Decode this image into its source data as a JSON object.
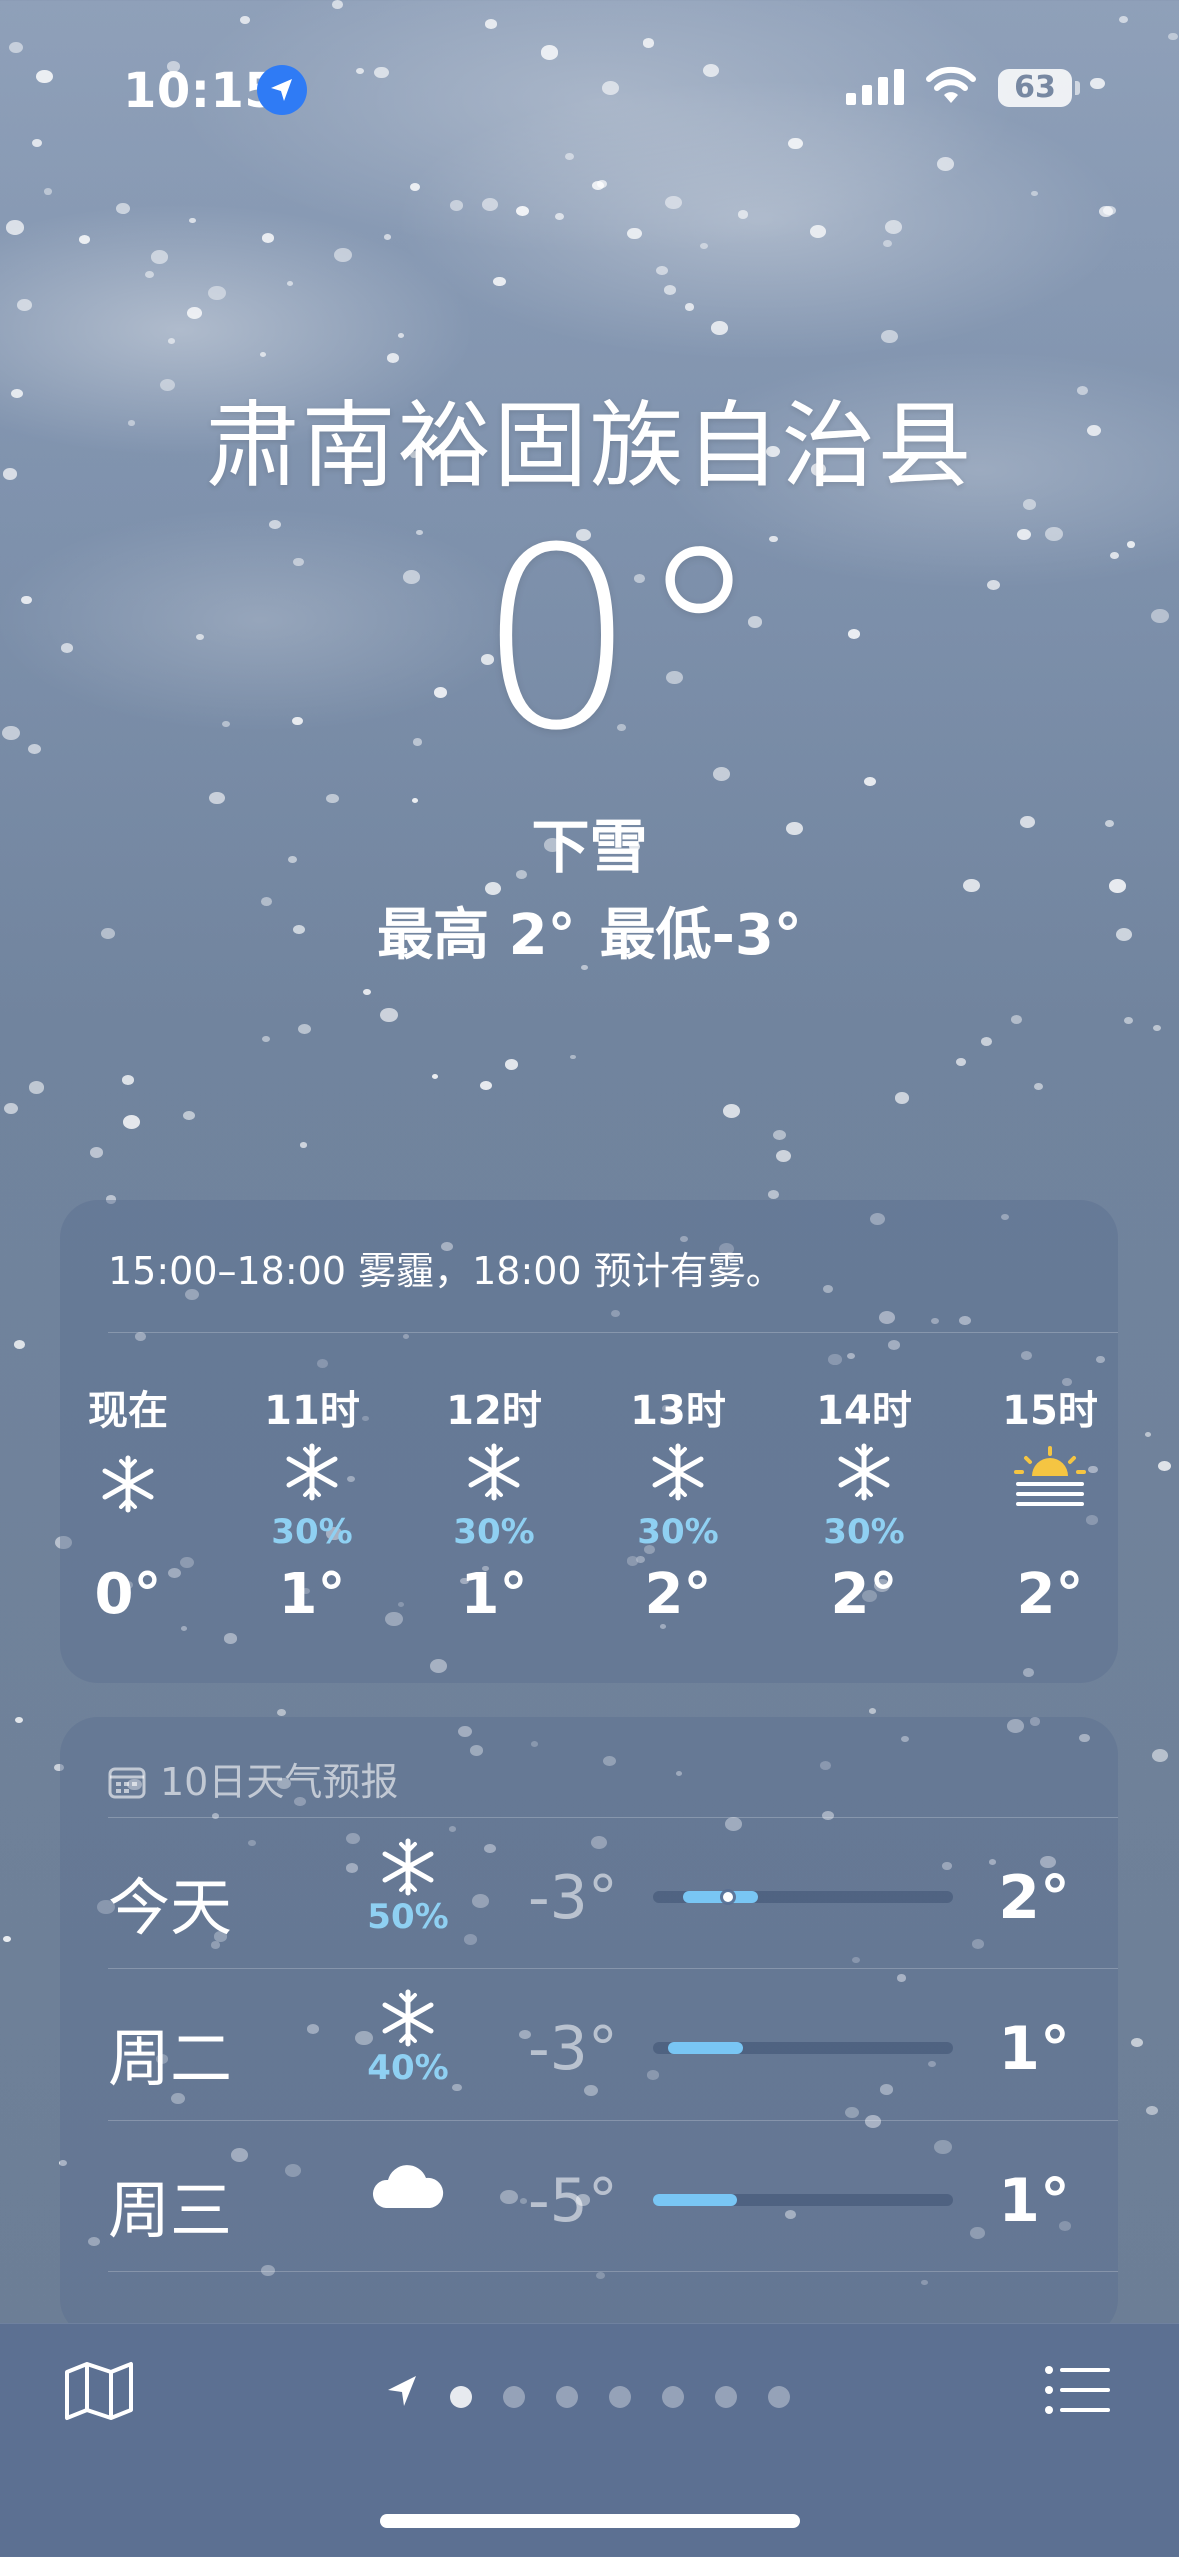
{
  "status_bar": {
    "time": "10:15",
    "battery": "63"
  },
  "hero": {
    "city": "肃南裕固族自治县",
    "temperature": "0°",
    "condition": "下雪",
    "high": "最高 2°",
    "low": "最低-3°"
  },
  "hourly": {
    "summary": "15:00–18:00 雾霾，18:00 预计有雾。",
    "items": [
      {
        "label": "现在",
        "icon": "snowflake-icon",
        "precip": "",
        "temp": "0°"
      },
      {
        "label": "11时",
        "icon": "snowflake-icon",
        "precip": "30%",
        "temp": "1°"
      },
      {
        "label": "12时",
        "icon": "snowflake-icon",
        "precip": "30%",
        "temp": "1°"
      },
      {
        "label": "13时",
        "icon": "snowflake-icon",
        "precip": "30%",
        "temp": "2°"
      },
      {
        "label": "14时",
        "icon": "snowflake-icon",
        "precip": "30%",
        "temp": "2°"
      },
      {
        "label": "15时",
        "icon": "sunrise-haze-icon",
        "precip": "",
        "temp": "2°"
      }
    ]
  },
  "daily": {
    "title": "10日天气预报",
    "rows": [
      {
        "day": "今天",
        "icon": "snowflake-icon",
        "precip": "50%",
        "low": "-3°",
        "high": "2°",
        "range_start": 0.1,
        "range_end": 0.35,
        "current": 0.25
      },
      {
        "day": "周二",
        "icon": "snowflake-icon",
        "precip": "40%",
        "low": "-3°",
        "high": "1°",
        "range_start": 0.05,
        "range_end": 0.3
      },
      {
        "day": "周三",
        "icon": "cloud-icon",
        "precip": "",
        "low": "-5°",
        "high": "1°",
        "range_start": 0.0,
        "range_end": 0.28
      }
    ]
  },
  "pager": {
    "page_count": 7,
    "active": 0
  },
  "colors": {
    "precip": "#8fd0f2",
    "bar_fill": "#79c6f4",
    "location_badge": "#2f7bf5"
  }
}
